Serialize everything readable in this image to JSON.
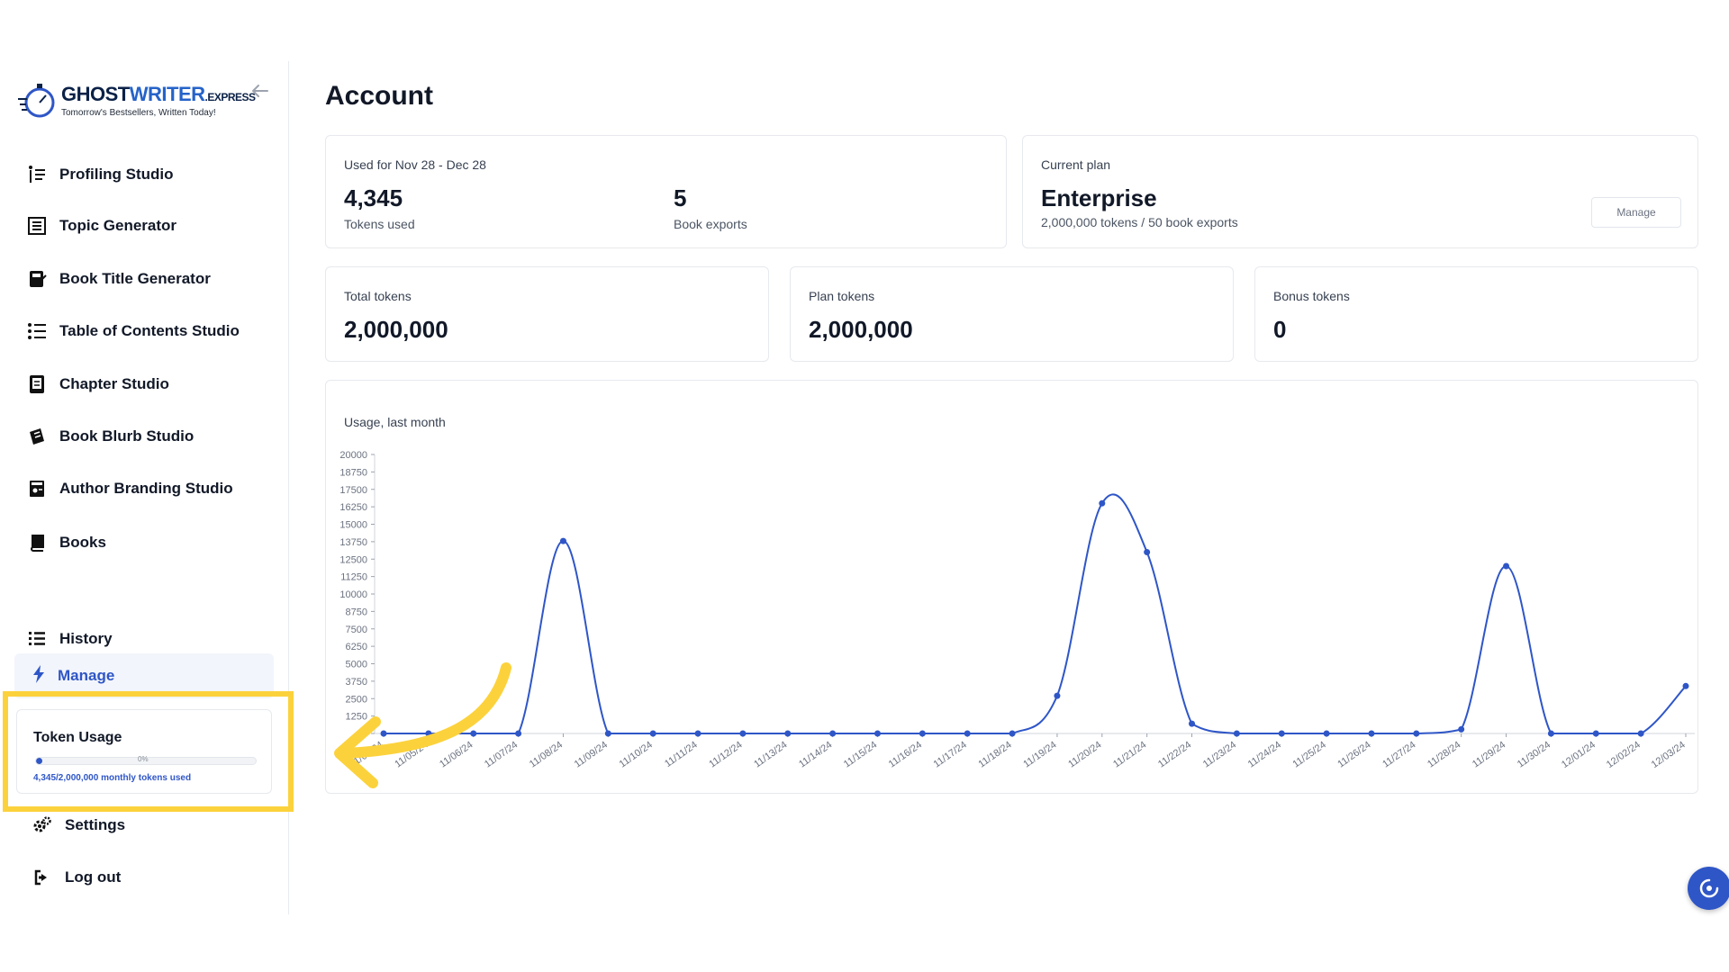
{
  "brand": {
    "name_part1": "GHOST",
    "name_part2": "WRITER",
    "name_suffix": ".EXPRESS",
    "tagline": "Tomorrow's Bestsellers, Written Today!"
  },
  "sidebar": {
    "items": [
      {
        "label": "Profiling Studio",
        "icon": "profiling-icon"
      },
      {
        "label": "Topic Generator",
        "icon": "topic-icon"
      },
      {
        "label": "Book Title Generator",
        "icon": "title-icon"
      },
      {
        "label": "Table of Contents Studio",
        "icon": "toc-icon"
      },
      {
        "label": "Chapter Studio",
        "icon": "chapter-icon"
      },
      {
        "label": "Book Blurb Studio",
        "icon": "blurb-icon"
      },
      {
        "label": "Author Branding Studio",
        "icon": "branding-icon"
      },
      {
        "label": "Books",
        "icon": "book-icon"
      },
      {
        "label": "History",
        "icon": "list-icon"
      }
    ],
    "manage_label": "Manage",
    "settings_label": "Settings",
    "logout_label": "Log out",
    "token_usage": {
      "title": "Token Usage",
      "percent_label": "0%",
      "fill_fraction": 0.002,
      "note": "4,345/2,000,000 monthly tokens used"
    }
  },
  "account": {
    "title": "Account",
    "usage_card": {
      "label": "Used for Nov 28 - Dec 28",
      "tokens_value": "4,345",
      "tokens_label": "Tokens used",
      "exports_value": "5",
      "exports_label": "Book exports"
    },
    "plan_card": {
      "label": "Current plan",
      "plan_name": "Enterprise",
      "plan_detail": "2,000,000 tokens / 50 book exports",
      "manage_button": "Manage"
    },
    "token_cards": [
      {
        "label": "Total tokens",
        "value": "2,000,000"
      },
      {
        "label": "Plan tokens",
        "value": "2,000,000"
      },
      {
        "label": "Bonus tokens",
        "value": "0"
      }
    ]
  },
  "chart_data": {
    "type": "line",
    "title": "Usage, last month",
    "x": [
      "11/04/24",
      "11/05/24",
      "11/06/24",
      "11/07/24",
      "11/08/24",
      "11/09/24",
      "11/10/24",
      "11/11/24",
      "11/12/24",
      "11/13/24",
      "11/14/24",
      "11/15/24",
      "11/16/24",
      "11/17/24",
      "11/18/24",
      "11/19/24",
      "11/20/24",
      "11/21/24",
      "11/22/24",
      "11/23/24",
      "11/24/24",
      "11/25/24",
      "11/26/24",
      "11/27/24",
      "11/28/24",
      "11/29/24",
      "11/30/24",
      "12/01/24",
      "12/02/24",
      "12/03/24"
    ],
    "values": [
      0,
      0,
      0,
      0,
      13800,
      0,
      0,
      0,
      0,
      0,
      0,
      0,
      0,
      0,
      0,
      2700,
      16500,
      13000,
      700,
      0,
      0,
      0,
      0,
      0,
      300,
      12000,
      0,
      0,
      0,
      3400
    ],
    "ylim": [
      0,
      20000
    ],
    "yticks": [
      0,
      1250,
      2500,
      3750,
      5000,
      6250,
      7500,
      8750,
      10000,
      11250,
      12500,
      13750,
      15000,
      16250,
      17500,
      18750,
      20000
    ],
    "color": "#2f56c7",
    "grid": false
  },
  "colors": {
    "accent": "#2f56c7",
    "highlight": "#fcd23c"
  }
}
